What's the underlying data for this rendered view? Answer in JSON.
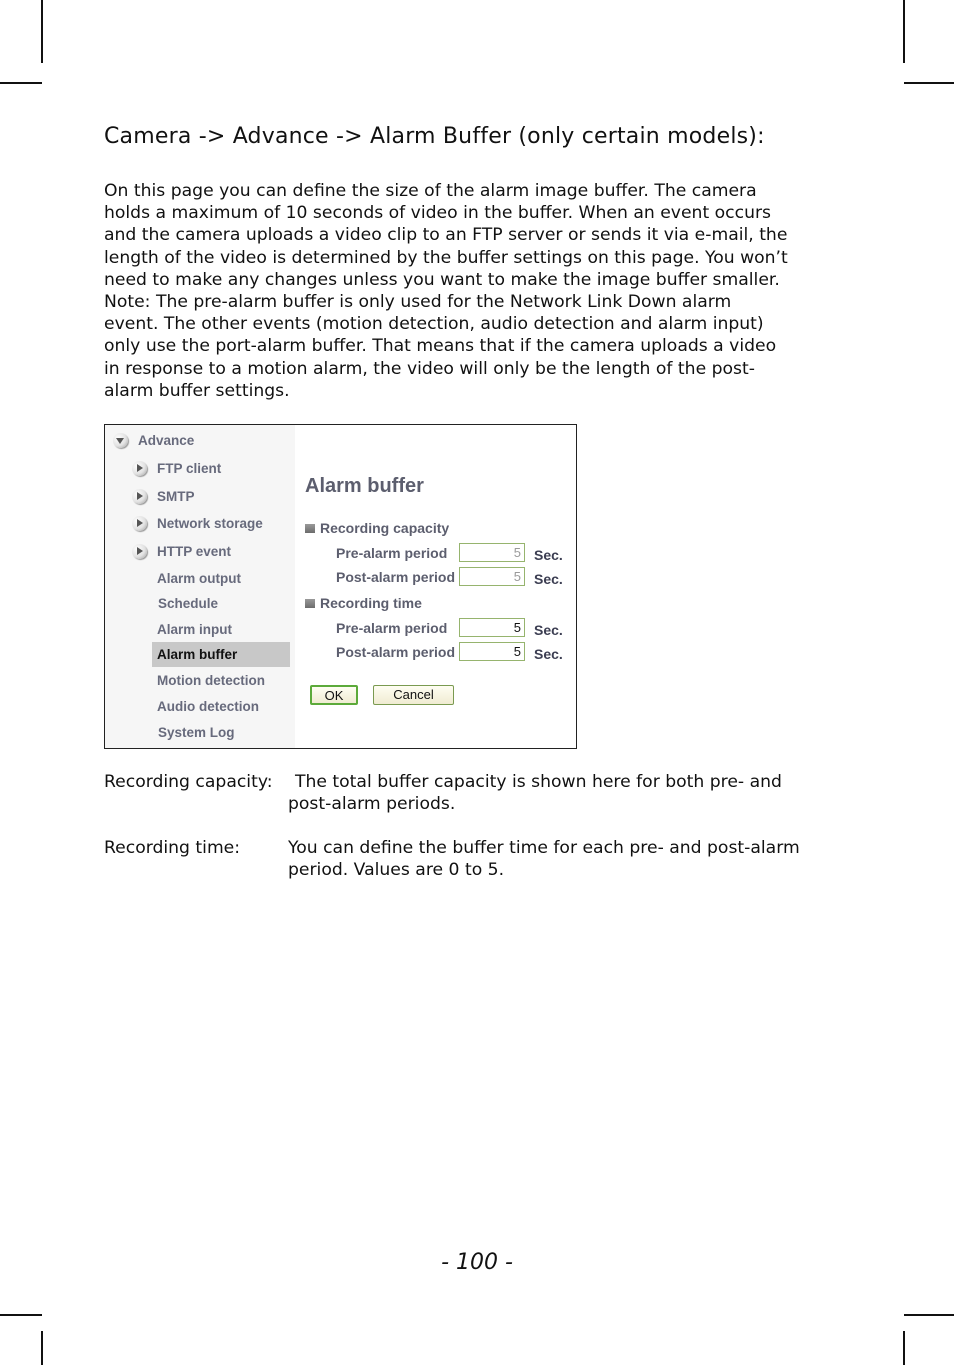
{
  "heading": "Camera -> Advance -> Alarm Buffer (only certain models):",
  "intro_lines": [
    "On this page you can define the size of the alarm image buffer. The camera",
    "holds a maximum of 10 seconds of video in the buffer. When an event occurs",
    "and the camera uploads a video clip to an FTP server or sends it via e-mail, the",
    "length of the video is determined by the buffer settings on this page. You won’t",
    "need to make any changes unless you want to make the image buffer smaller.",
    "Note: The pre-alarm buffer is only used for the Network Link Down alarm",
    "event. The other events (motion detection, audio detection and alarm input)",
    "only use the port-alarm buffer. That means that if the camera uploads a video",
    "in response to a motion alarm, the video will only be the length of the post-",
    "alarm buffer settings."
  ],
  "screenshot": {
    "sidebar": {
      "root": "Advance",
      "items": [
        {
          "label": "FTP client",
          "expandable": true
        },
        {
          "label": "SMTP",
          "expandable": true
        },
        {
          "label": "Network storage",
          "expandable": true
        },
        {
          "label": "HTTP event",
          "expandable": true
        },
        {
          "label": "Alarm output",
          "expandable": false
        },
        {
          "label": "Schedule",
          "expandable": false
        },
        {
          "label": "Alarm input",
          "expandable": false
        },
        {
          "label": "Alarm buffer",
          "expandable": false,
          "active": true
        },
        {
          "label": "Motion detection",
          "expandable": false
        },
        {
          "label": "Audio detection",
          "expandable": false
        },
        {
          "label": "System Log",
          "expandable": false
        }
      ]
    },
    "title": "Alarm buffer",
    "recording_capacity": {
      "heading": "Recording capacity",
      "pre_label": "Pre-alarm period",
      "pre_value": "5",
      "post_label": "Post-alarm period",
      "post_value": "5",
      "unit": "Sec."
    },
    "recording_time": {
      "heading": "Recording time",
      "pre_label": "Pre-alarm period",
      "pre_value": "5",
      "post_label": "Post-alarm period",
      "post_value": "5",
      "unit": "Sec."
    },
    "ok_label": "OK",
    "cancel_label": "Cancel"
  },
  "definitions": [
    {
      "term": "Recording capacity:",
      "lines": [
        "The total buffer capacity is shown here for both pre- and",
        "post-alarm periods."
      ]
    },
    {
      "term": "Recording time:",
      "lines": [
        "You can define the buffer time for each pre- and post-alarm",
        "period. Values are 0 to 5."
      ]
    }
  ],
  "page_number": "- 100 -"
}
